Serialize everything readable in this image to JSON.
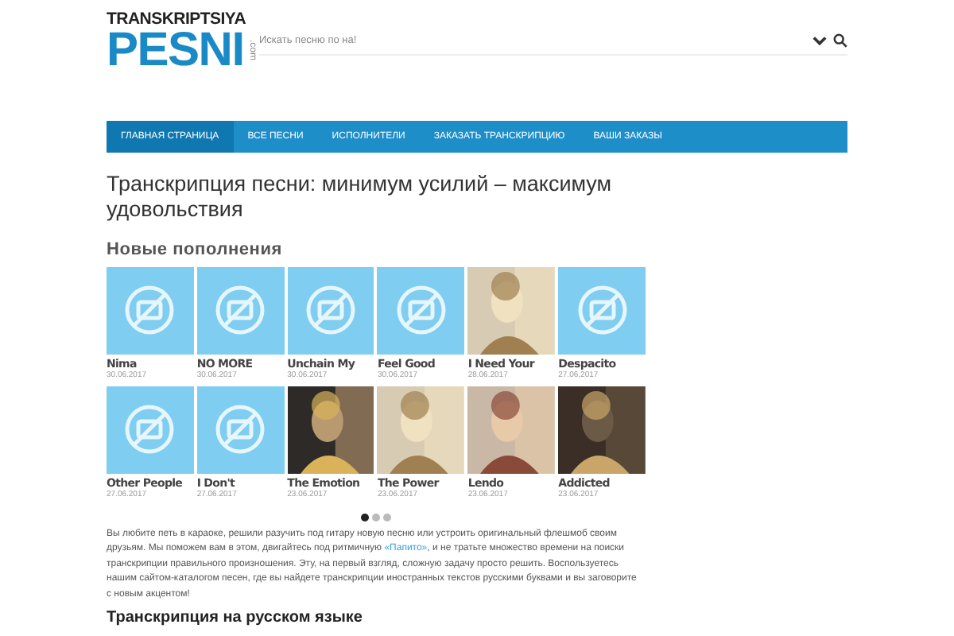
{
  "logo": {
    "top": "TRANSKRIPTSIYA",
    "main": "PESNI",
    "suffix": ".com"
  },
  "search": {
    "placeholder": "Искать песню по на!"
  },
  "nav": [
    {
      "label": "ГЛАВНАЯ СТРАНИЦА",
      "selected": true
    },
    {
      "label": "ВСЕ ПЕСНИ",
      "selected": false
    },
    {
      "label": "ИСПОЛНИТЕЛИ",
      "selected": false
    },
    {
      "label": "ЗАКАЗАТЬ ТРАНСКРИПЦИЮ",
      "selected": false
    },
    {
      "label": "ВАШИ ЗАКАЗЫ",
      "selected": false
    }
  ],
  "headline": "Транскрипция песни: минимум усилий – максимум удовольствия",
  "new_section": {
    "title": "Новые пополнения",
    "songs": [
      {
        "title": "Nima",
        "date": "30.06.2017",
        "kind": "placeholder"
      },
      {
        "title": "NO MORE",
        "date": "30.06.2017",
        "kind": "placeholder"
      },
      {
        "title": "Unchain My",
        "date": "30.06.2017",
        "kind": "placeholder"
      },
      {
        "title": "Feel Good",
        "date": "30.06.2017",
        "kind": "placeholder"
      },
      {
        "title": "I Need Your",
        "date": "28.06.2017",
        "kind": "picture"
      },
      {
        "title": "Despacito",
        "date": "27.06.2017",
        "kind": "placeholder"
      },
      {
        "title": "Other People",
        "date": "27.06.2017",
        "kind": "placeholder"
      },
      {
        "title": "I Don't",
        "date": "27.06.2017",
        "kind": "placeholder"
      },
      {
        "title": "The Emotion",
        "date": "23.06.2017",
        "kind": "picture"
      },
      {
        "title": "The Power",
        "date": "23.06.2017",
        "kind": "picture"
      },
      {
        "title": "Lendo",
        "date": "23.06.2017",
        "kind": "picture"
      },
      {
        "title": "Addicted",
        "date": "23.06.2017",
        "kind": "picture"
      }
    ],
    "pager": [
      {
        "selected": true
      },
      {
        "selected": false
      },
      {
        "selected": false
      }
    ]
  },
  "intro": {
    "before": "Вы любите петь в караоке, решили разучить под гитару новую песню или устроить оригинальный флешмоб своим друзьям. Мы поможем вам в этом, двигайтесь под ритмичную ",
    "link": "«Папито»",
    "after": ", и не тратьте множество времени на поиски транскрипции правильного произношения. Эту, на первый взгляд, сложную задачу просто решить. Воспользуетесь нашим сайтом-каталогом песен, где вы найдете транскрипции иностранных текстов русскими буквами и вы заговорите с новым акцентом!"
  },
  "next_heading": "Транскрипция на русском языке"
}
